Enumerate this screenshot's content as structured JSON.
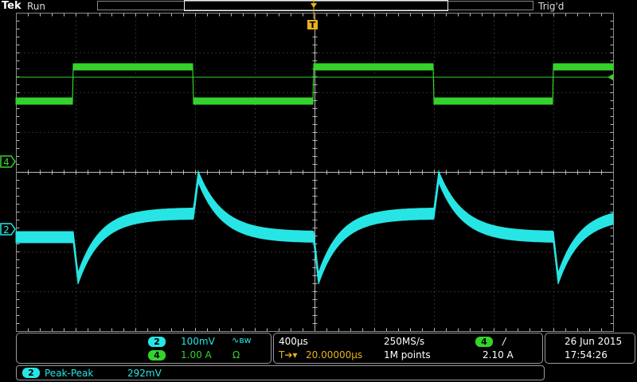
{
  "header": {
    "brand": "Tek",
    "run_state": "Run",
    "trigger_state": "Trig'd"
  },
  "channels": {
    "ch4": {
      "marker": "4",
      "color": "#34d32b"
    },
    "ch2": {
      "marker": "2",
      "color": "#27e5e5"
    }
  },
  "trigger": {
    "marker": "T"
  },
  "vertical": {
    "ch2_badge": "2",
    "ch2_scale": "100mV",
    "ch2_coupling_icon": "bandwidth-limit-icon",
    "ch4_badge": "4",
    "ch4_scale": "1.00 A",
    "ch4_impedance": "Ω"
  },
  "horizontal": {
    "timebase": "400µs",
    "sample_rate": "250MS/s",
    "trigger_position_symbol": "T➔▾",
    "delay": "20.00000µs",
    "record_length": "1M points",
    "trigger_source_badge": "4",
    "trigger_slope": "/",
    "trigger_level": "2.10 A"
  },
  "datetime": {
    "date": "26 Jun  2015",
    "time": "17:54:26"
  },
  "measurement": {
    "badge": "2",
    "name": "Peak-Peak",
    "value": "292mV"
  }
}
